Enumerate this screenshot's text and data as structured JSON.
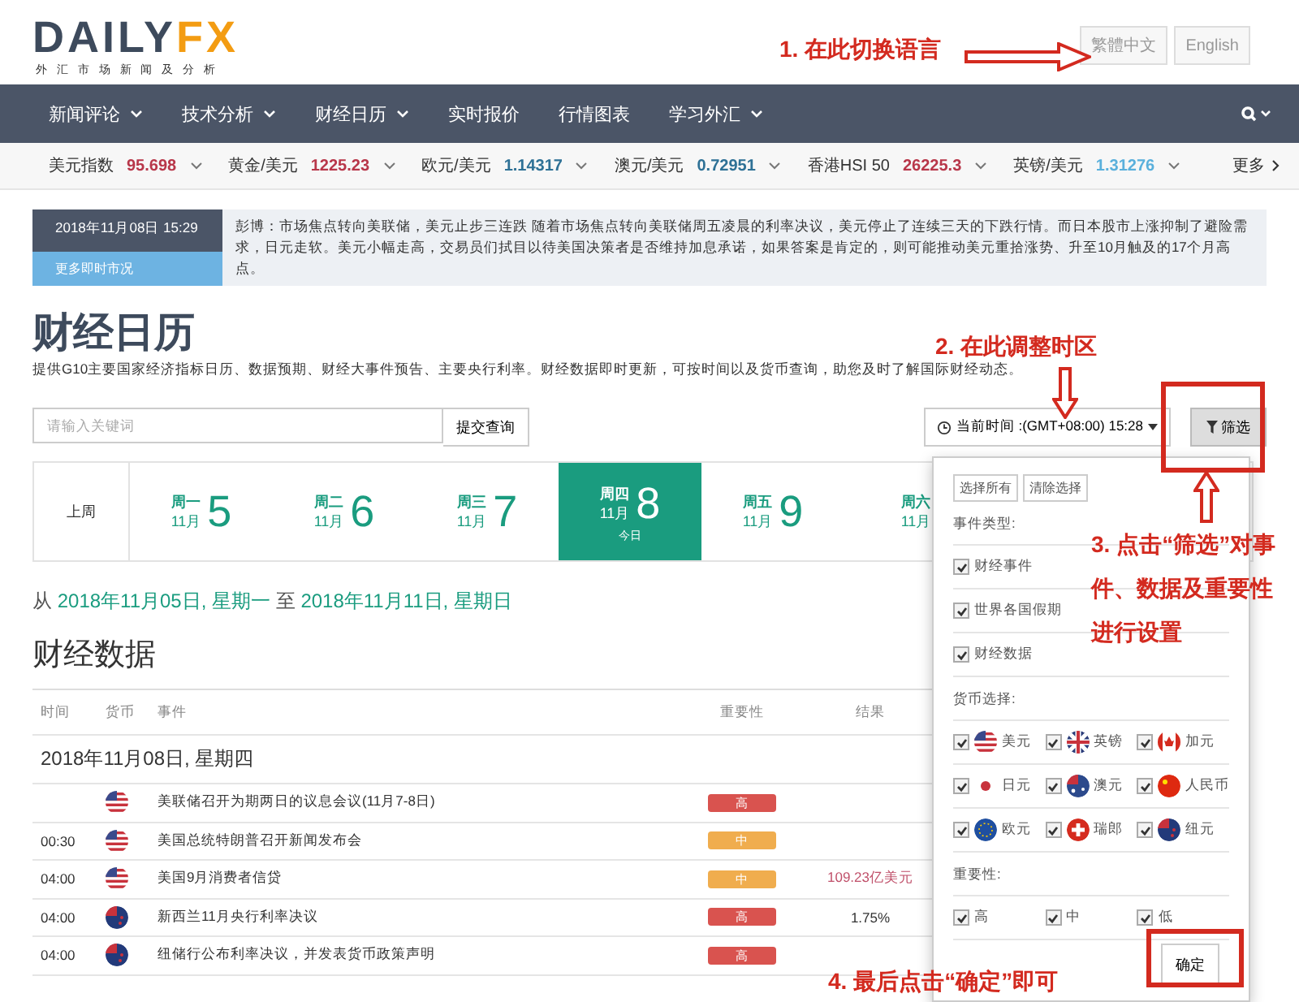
{
  "header": {
    "logo_main": "DAILY",
    "logo_accent": "FX",
    "tagline": "外 汇 市 场 新 闻 及 分 析",
    "languages": [
      {
        "label": "繁體中文",
        "selected": false
      },
      {
        "label": "English",
        "selected": false
      }
    ]
  },
  "nav": {
    "items": [
      {
        "label": "新闻评论",
        "dropdown": true
      },
      {
        "label": "技术分析",
        "dropdown": true
      },
      {
        "label": "财经日历",
        "dropdown": true
      },
      {
        "label": "实时报价",
        "dropdown": false
      },
      {
        "label": "行情图表",
        "dropdown": false
      },
      {
        "label": "学习外汇",
        "dropdown": true
      }
    ]
  },
  "ticker": {
    "items": [
      {
        "name": "美元指数",
        "value": "95.698",
        "color": "#b8374a"
      },
      {
        "name": "黄金/美元",
        "value": "1225.23",
        "color": "#b8374a"
      },
      {
        "name": "欧元/美元",
        "value": "1.14317",
        "color": "#2e7196"
      },
      {
        "name": "澳元/美元",
        "value": "0.72951",
        "color": "#2e7196"
      },
      {
        "name": "香港HSI 50",
        "value": "26225.3",
        "color": "#b8374a"
      },
      {
        "name": "英镑/美元",
        "value": "1.31276",
        "color": "#5ab0dc"
      }
    ],
    "more": "更多"
  },
  "news": {
    "datetime": "2018年11月08日 15:29",
    "more_link": "更多即时市况",
    "text": "彭博：市场焦点转向美联储，美元止步三连跌 随着市场焦点转向美联储周五凌晨的利率决议，美元停止了连续三天的下跌行情。而日本股市上涨抑制了避险需求，日元走软。美元小幅走高，交易员们拭目以待美国决策者是否维持加息承诺，如果答案是肯定的，则可能推动美元重拾涨势、升至10月触及的17个月高点。"
  },
  "calendar": {
    "title": "财经日历",
    "description": "提供G10主要国家经济指标日历、数据预期、财经大事件预告、主要央行利率。财经数据即时更新，可按时间以及货币查询，助您及时了解国际财经动态。",
    "search": {
      "placeholder": "请输入关键词",
      "button": "提交查询"
    },
    "timezone": "当前时间 :(GMT+08:00) 15:28",
    "filter_button": "筛选",
    "prev_week": "上周",
    "days": [
      {
        "weekday": "周一",
        "month": "11月",
        "day": "5",
        "selected": false
      },
      {
        "weekday": "周二",
        "month": "11月",
        "day": "6",
        "selected": false
      },
      {
        "weekday": "周三",
        "month": "11月",
        "day": "7",
        "selected": false
      },
      {
        "weekday": "周四",
        "month": "11月",
        "day": "8",
        "today": "今日",
        "selected": true
      },
      {
        "weekday": "周五",
        "month": "11月",
        "day": "9",
        "selected": false
      },
      {
        "weekday": "周六",
        "month": "11月",
        "selected": false
      }
    ],
    "range": {
      "from_word": "从",
      "from": "2018年11月05日, 星期一",
      "to_word": "至",
      "to": "2018年11月11日, 星期日"
    }
  },
  "data": {
    "title": "财经数据",
    "columns": [
      "时间",
      "货币",
      "事件",
      "重要性",
      "结果"
    ],
    "date_heading": "2018年11月08日, 星期四",
    "rows": [
      {
        "flag": {
          "kind": "us"
        },
        "event": "美联储召开为期两日的议息会议(11月7-8日)",
        "importance": {
          "label": "高",
          "color": "#d9534f"
        }
      },
      {
        "time": "00:30",
        "flag": {
          "kind": "us"
        },
        "event": "美国总统特朗普召开新闻发布会",
        "importance": {
          "label": "中",
          "color": "#f0ad4e"
        }
      },
      {
        "time": "04:00",
        "flag": {
          "kind": "us"
        },
        "event": "美国9月消费者信贷",
        "importance": {
          "label": "中",
          "color": "#f0ad4e"
        },
        "result": {
          "text": "109.23亿美元",
          "color": "#c0506a"
        }
      },
      {
        "time": "04:00",
        "flag": {
          "kind": "nz"
        },
        "event": "新西兰11月央行利率决议",
        "importance": {
          "label": "高",
          "color": "#d9534f"
        },
        "result": {
          "text": "1.75%"
        }
      },
      {
        "time": "04:00",
        "flag": {
          "kind": "nz"
        },
        "event": "纽储行公布利率决议，并发表货币政策声明",
        "importance": {
          "label": "高",
          "color": "#d9534f"
        }
      }
    ]
  },
  "filter_panel": {
    "buttons": [
      "选择所有",
      "清除选择"
    ],
    "sections": [
      {
        "title": "事件类型:",
        "kind": "list",
        "options": [
          {
            "label": "财经事件",
            "checked": true
          },
          {
            "label": "世界各国假期",
            "checked": true
          },
          {
            "label": "财经数据",
            "checked": true
          }
        ]
      },
      {
        "title": "货币选择:",
        "kind": "grid",
        "options": [
          {
            "label": "美元",
            "checked": true,
            "flag": {
              "kind": "us"
            }
          },
          {
            "label": "英镑",
            "checked": true,
            "flag": {
              "kind": "gb"
            }
          },
          {
            "label": "加元",
            "checked": true,
            "flag": {
              "kind": "ca"
            }
          },
          {
            "label": "日元",
            "checked": true,
            "flag": {
              "kind": "jp"
            }
          },
          {
            "label": "澳元",
            "checked": true,
            "flag": {
              "kind": "au"
            }
          },
          {
            "label": "人民币",
            "checked": true,
            "flag": {
              "kind": "cn"
            }
          },
          {
            "label": "欧元",
            "checked": true,
            "flag": {
              "kind": "eu"
            }
          },
          {
            "label": "瑞郎",
            "checked": true,
            "flag": {
              "kind": "ch"
            }
          },
          {
            "label": "纽元",
            "checked": true,
            "flag": {
              "kind": "nz"
            }
          }
        ]
      },
      {
        "title": "重要性:",
        "kind": "grid",
        "options": [
          {
            "label": "高",
            "checked": true
          },
          {
            "label": "中",
            "checked": true
          },
          {
            "label": "低",
            "checked": true
          }
        ]
      }
    ],
    "confirm": "确定"
  },
  "annotations": [
    {
      "text": "1. 在此切换语言"
    },
    {
      "text": "2. 在此调整时区"
    },
    {
      "text": "3. 点击“筛选”对事件、数据及重要性进行设置"
    },
    {
      "text": "4. 最后点击“确定”即可"
    }
  ]
}
